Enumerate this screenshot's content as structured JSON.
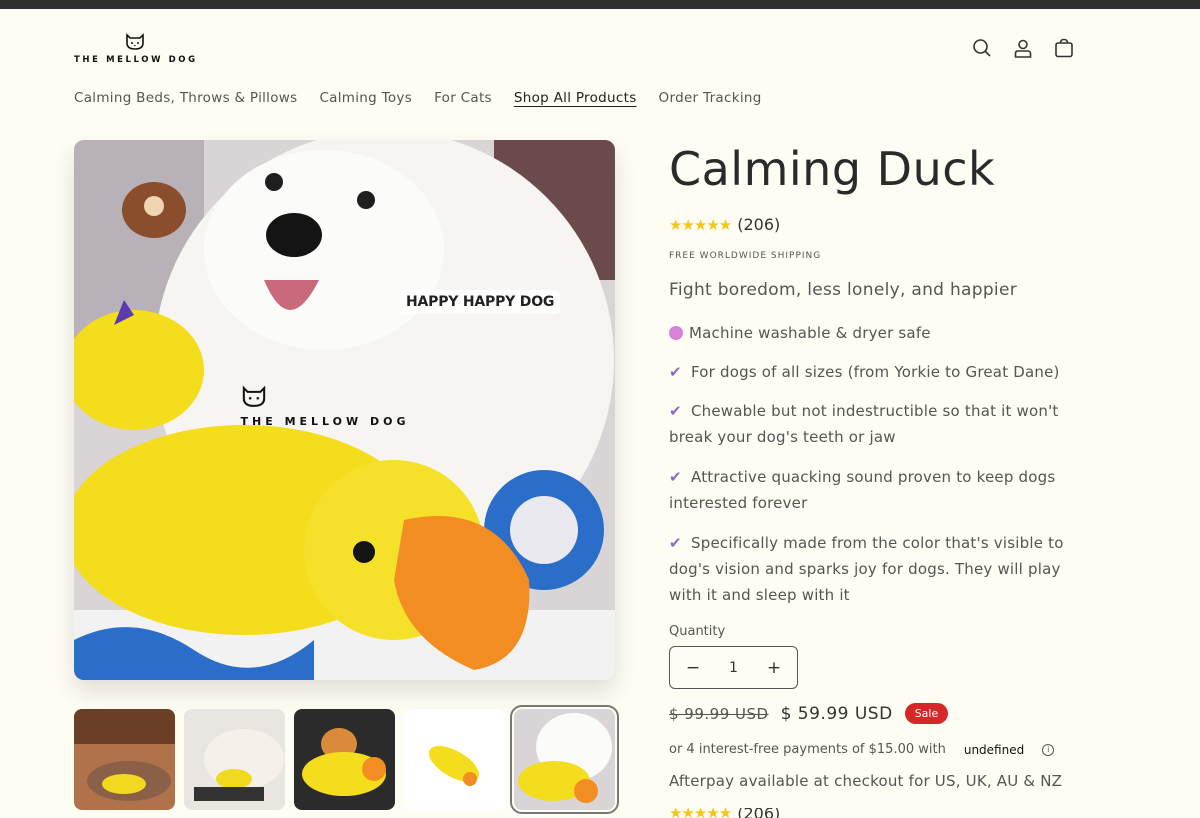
{
  "header": {
    "logo_text": "THE MELLOW DOG",
    "icons": [
      "search-icon",
      "account-icon",
      "cart-icon"
    ]
  },
  "nav": {
    "items": [
      {
        "label": "Calming Beds, Throws & Pillows",
        "active": false
      },
      {
        "label": "Calming Toys",
        "active": false
      },
      {
        "label": "For Cats",
        "active": false
      },
      {
        "label": "Shop All Products",
        "active": true
      },
      {
        "label": "Order Tracking",
        "active": false
      }
    ]
  },
  "gallery": {
    "main_overlay_text": "HAPPY HAPPY DOG",
    "main_overlay_logo": "THE MELLOW DOG",
    "thumbnails_count": 5,
    "selected_thumbnail": 5
  },
  "product": {
    "title": "Calming Duck",
    "stars": "★★★★★",
    "review_count": "(206)",
    "shipping": "FREE WORLDWIDE SHIPPING",
    "tagline": "Fight boredom, less lonely, and happier",
    "features": [
      {
        "icon": "yarn-icon",
        "text": "Machine washable & dryer safe"
      },
      {
        "icon": "check-icon",
        "text": "For dogs of all sizes (from Yorkie to Great Dane)"
      },
      {
        "icon": "check-icon",
        "text": "Chewable but not indestructible so that it won't break your dog's teeth or jaw"
      },
      {
        "icon": "check-icon",
        "text": "Attractive quacking sound proven to keep dogs interested forever"
      },
      {
        "icon": "check-icon",
        "text": "Specifically made from the color that's visible to dog's vision and sparks joy for dogs. They will play with it and sleep with it"
      }
    ],
    "quantity_label": "Quantity",
    "quantity_value": "1",
    "minus": "−",
    "plus": "+",
    "old_price": "$ 99.99 USD",
    "new_price": "$ 59.99 USD",
    "sale_badge": "Sale",
    "installments": "or 4 interest-free payments of $15.00 with",
    "provider": "undefined",
    "afterpay": "Afterpay available at checkout for US, UK, AU & NZ",
    "review_count_2": "(206)"
  }
}
